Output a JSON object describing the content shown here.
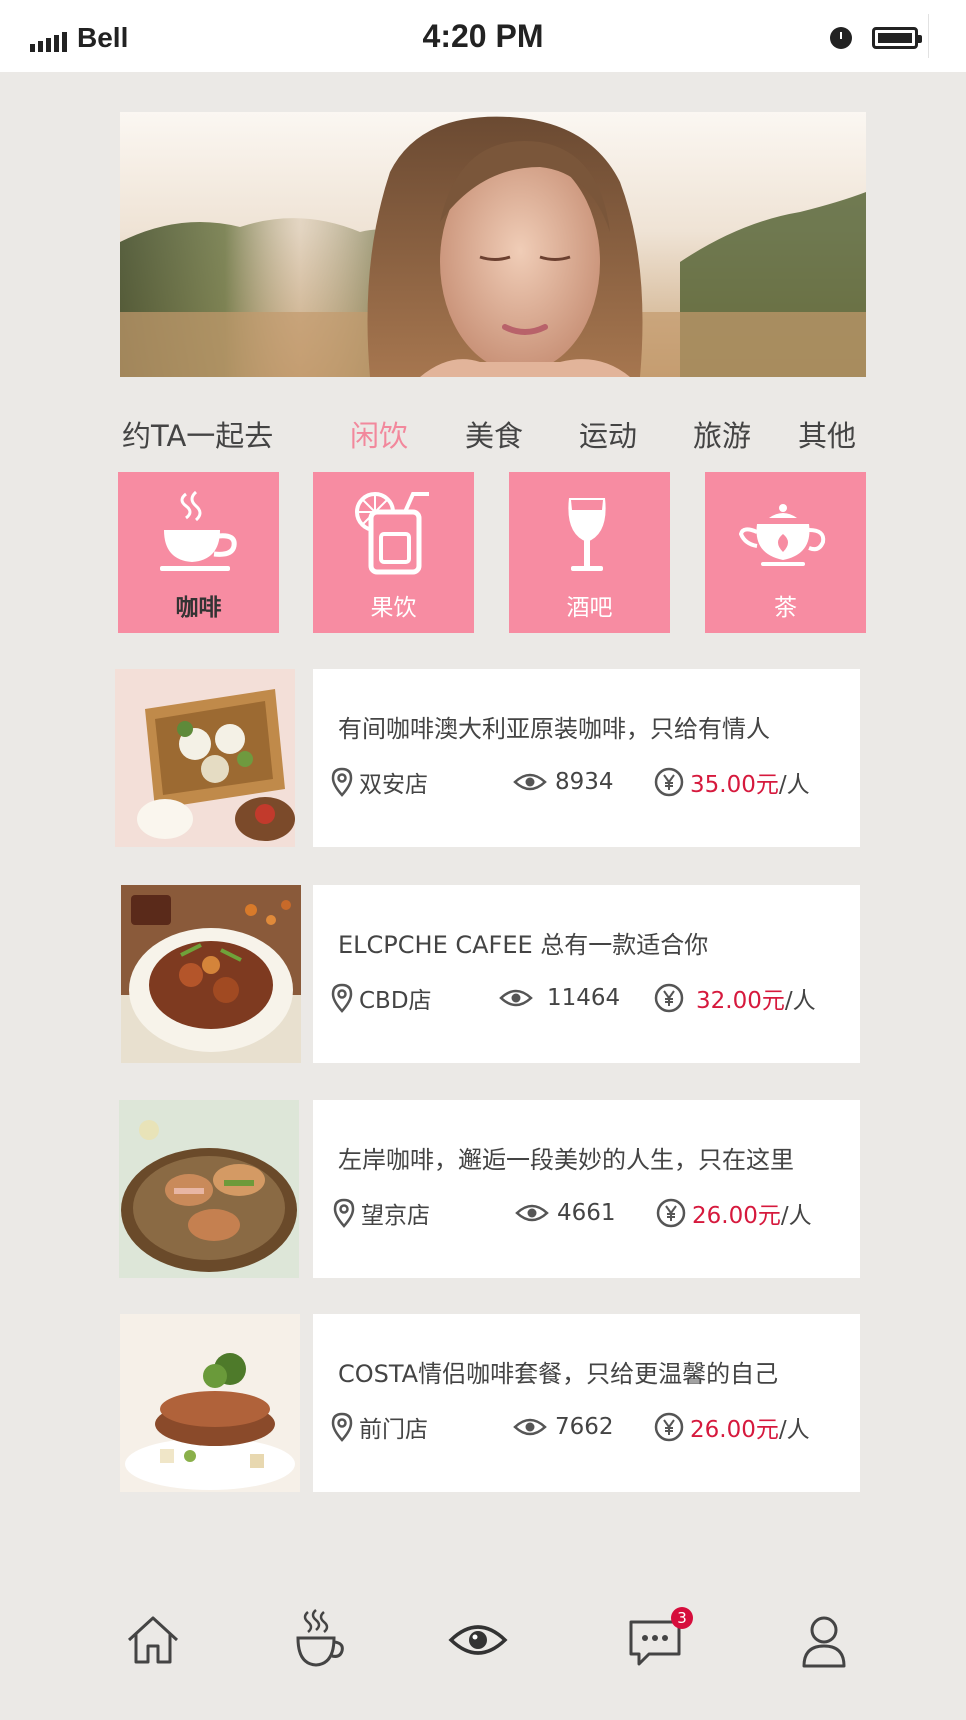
{
  "status_bar": {
    "carrier": "Bell",
    "time": "4:20 PM"
  },
  "hero": {
    "alt": "woman portrait"
  },
  "category": {
    "title": "约TA一起去",
    "tabs": [
      {
        "label": "闲饮",
        "active": true
      },
      {
        "label": "美食",
        "active": false
      },
      {
        "label": "运动",
        "active": false
      },
      {
        "label": "旅游",
        "active": false
      },
      {
        "label": "其他",
        "active": false
      }
    ]
  },
  "tiles": [
    {
      "label": "咖啡",
      "icon": "coffee-cup-icon",
      "selected": true
    },
    {
      "label": "果饮",
      "icon": "juice-icon",
      "selected": false
    },
    {
      "label": "酒吧",
      "icon": "wine-glass-icon",
      "selected": false
    },
    {
      "label": "茶",
      "icon": "teapot-icon",
      "selected": false
    }
  ],
  "listings": [
    {
      "title": "有间咖啡澳大利亚原装咖啡，只给有情人",
      "store": "双安店",
      "views": "8934",
      "price": "35.00元",
      "unit": "/人"
    },
    {
      "title": "ELCPCHE  CAFEE  总有一款适合你",
      "store": "CBD店",
      "views": "11464",
      "price": "32.00元",
      "unit": "/人"
    },
    {
      "title": "左岸咖啡，邂逅一段美妙的人生，只在这里",
      "store": "望京店",
      "views": "4661",
      "price": "26.00元",
      "unit": "/人"
    },
    {
      "title": "COSTA情侣咖啡套餐，只给更温馨的自己",
      "store": "前门店",
      "views": "7662",
      "price": "26.00元",
      "unit": "/人"
    }
  ],
  "bottom_nav": {
    "items": [
      "home-icon",
      "coffee-icon",
      "eye-icon",
      "message-icon",
      "user-icon"
    ],
    "message_badge": "3"
  },
  "colors": {
    "accent": "#f78ca2",
    "price": "#d6193d",
    "background": "#ebe9e6"
  }
}
